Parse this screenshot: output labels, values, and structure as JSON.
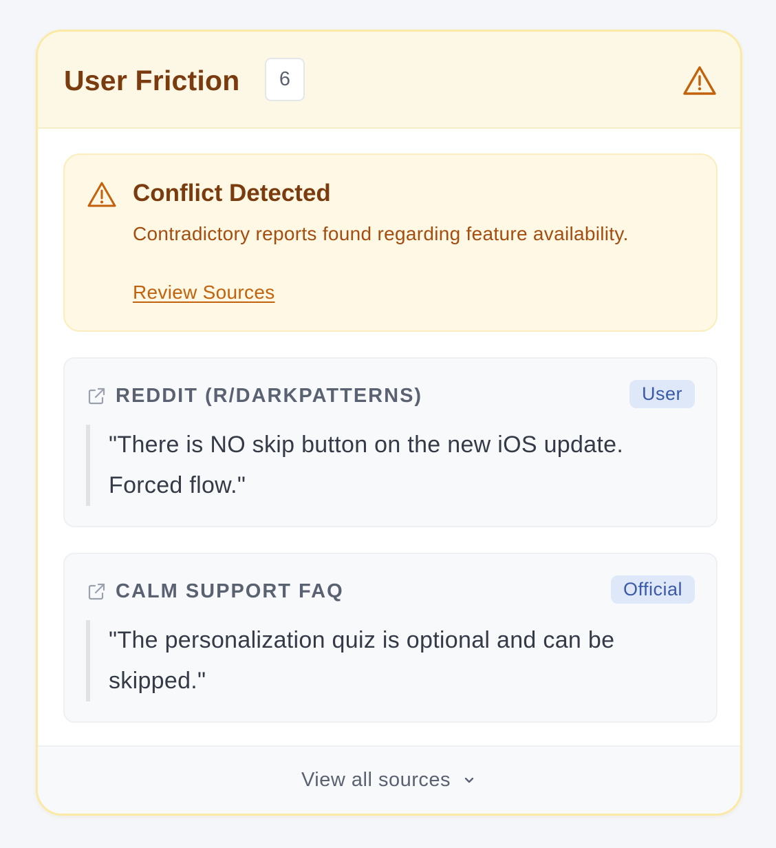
{
  "header": {
    "title": "User Friction",
    "count": "6",
    "icon": "warning-triangle-icon"
  },
  "conflict": {
    "icon": "warning-triangle-icon",
    "title": "Conflict Detected",
    "description": "Contradictory reports found regarding feature availability.",
    "link_label": "Review Sources"
  },
  "sources": [
    {
      "icon": "external-link-icon",
      "name": "REDDIT (R/DARKPATTERNS)",
      "tag": "User",
      "quote": "\"There is NO skip button on the new iOS update. Forced flow.\""
    },
    {
      "icon": "external-link-icon",
      "name": "CALM SUPPORT FAQ",
      "tag": "Official",
      "quote": "\"The personalization quiz is optional and can be skipped.\""
    }
  ],
  "footer": {
    "label": "View all sources",
    "icon": "chevron-down-icon"
  },
  "colors": {
    "title_brown": "#7a3b0e",
    "warning_orange": "#c2620c",
    "header_bg": "#fdf8e6",
    "card_border": "#fbe9a6",
    "tag_bg": "#dfe8f9",
    "tag_text": "#3a5aa8"
  }
}
